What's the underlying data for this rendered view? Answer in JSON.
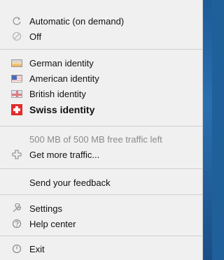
{
  "menu": {
    "items": [
      {
        "label": "Automatic (on demand)",
        "icon": "refresh-icon"
      },
      {
        "label": "Off",
        "icon": "disabled-icon"
      },
      {
        "label": "German identity",
        "icon": "germany-flag-icon"
      },
      {
        "label": "American identity",
        "icon": "usa-flag-icon"
      },
      {
        "label": "British identity",
        "icon": "uk-flag-icon"
      },
      {
        "label": "Swiss identity",
        "icon": "swiss-flag-icon"
      },
      {
        "label": "500 MB of 500 MB free traffic left"
      },
      {
        "label": "Get more traffic...",
        "icon": "plus-icon"
      },
      {
        "label": "Send your feedback"
      },
      {
        "label": "Settings",
        "icon": "wrench-icon"
      },
      {
        "label": "Help center",
        "icon": "help-icon"
      },
      {
        "label": "Exit",
        "icon": "power-icon"
      }
    ]
  },
  "colors": {
    "menu_bg": "#f0f0f0",
    "text": "#111111",
    "disabled_text": "#8b8b8b",
    "swiss_red": "#e12c2c",
    "window_blue": "#1f5f9a"
  }
}
